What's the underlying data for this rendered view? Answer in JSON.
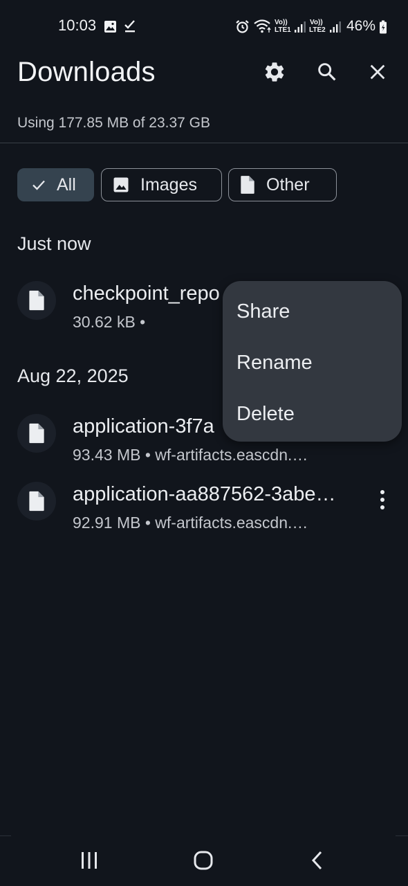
{
  "status_bar": {
    "time": "10:03",
    "sim1_volte": "Vo))",
    "sim1_lte": "LTE1",
    "sim2_volte": "Vo))",
    "sim2_lte": "LTE2",
    "battery": "46%",
    "icons": [
      "gallery-icon",
      "check-icon",
      "alarm-icon",
      "wifi-icon",
      "signal-icon",
      "signal-icon",
      "battery-icon"
    ]
  },
  "header": {
    "title": "Downloads",
    "storage": "Using 177.85 MB of 23.37 GB",
    "actions": [
      "settings-icon",
      "search-icon",
      "close-icon"
    ]
  },
  "filters": [
    {
      "label": "All",
      "selected": true,
      "icon": "check-icon"
    },
    {
      "label": "Images",
      "selected": false,
      "icon": "image-icon"
    },
    {
      "label": "Other",
      "selected": false,
      "icon": "file-icon"
    }
  ],
  "sections": [
    {
      "header": "Just now",
      "items": [
        {
          "name": "checkpoint_repo",
          "meta": "30.62 kB •",
          "icon": "file-icon"
        }
      ]
    },
    {
      "header": "Aug 22, 2025",
      "items": [
        {
          "name": "application-3f7a",
          "meta": "93.43 MB • wf-artifacts.eascdn.…",
          "icon": "file-icon"
        },
        {
          "name": "application-aa887562-3abe…",
          "meta": "92.91 MB • wf-artifacts.eascdn.…",
          "icon": "file-icon"
        }
      ]
    }
  ],
  "context_menu": {
    "items": [
      "Share",
      "Rename",
      "Delete"
    ]
  },
  "nav_bar": {
    "buttons": [
      "recents-icon",
      "home-icon",
      "back-icon"
    ]
  },
  "colors": {
    "background": "#11151c",
    "menu_background": "#333840",
    "chip_selected": "#35434f",
    "text_primary": "#eceef1",
    "text_secondary": "#c4c7cd"
  }
}
